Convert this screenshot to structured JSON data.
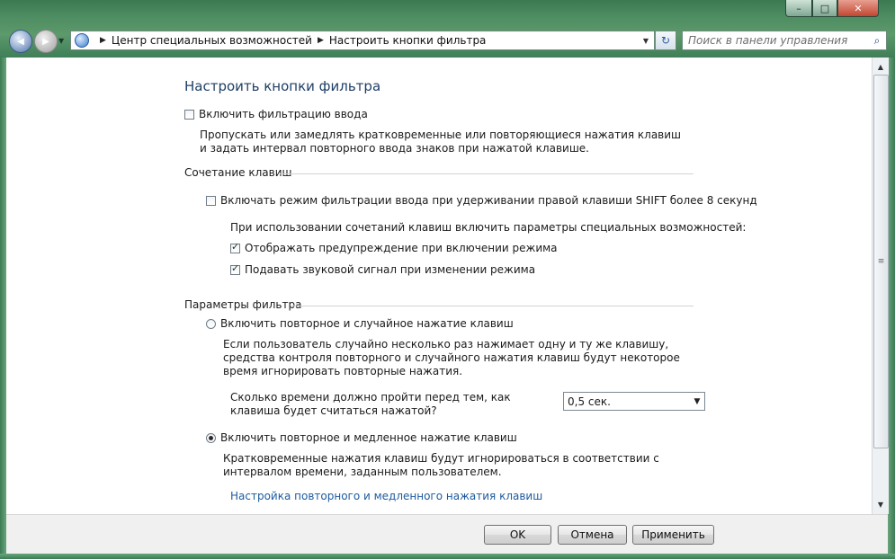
{
  "window": {
    "controls": {
      "minimize": "–",
      "maximize": "□",
      "close": "✕"
    }
  },
  "nav": {
    "back_icon": "◀",
    "forward_icon": "▶",
    "dropdown_icon": "▼"
  },
  "address": {
    "breadcrumbs": [
      "Центр специальных возможностей",
      "Настроить кнопки фильтра"
    ],
    "separator": "▶",
    "dropdown_icon": "▼"
  },
  "refresh_icon": "↻",
  "search": {
    "placeholder": "Поиск в панели управления",
    "icon": "⌕"
  },
  "page": {
    "title": "Настроить кнопки фильтра",
    "enable_filter": {
      "label": "Включить фильтрацию ввода",
      "checked": false
    },
    "enable_filter_desc": "Пропускать или замедлять кратковременные или повторяющиеся нажатия клавиш и задать интервал повторного ввода знаков при нажатой клавише.",
    "shortcut_group": {
      "title": "Сочетание клавиш",
      "shift_option": {
        "label": "Включать режим фильтрации ввода при удерживании правой клавиши SHIFT более 8 секунд",
        "checked": false
      },
      "shortcut_hint": "При использовании сочетаний клавиш включить параметры специальных возможностей:",
      "warning_option": {
        "label": "Отображать предупреждение при включении режима",
        "checked": true
      },
      "sound_option": {
        "label": "Подавать звуковой сигнал при изменении режима",
        "checked": true
      }
    },
    "filter_group": {
      "title": "Параметры фильтра",
      "repeat_random": {
        "label": "Включить повторное и случайное нажатие клавиш",
        "selected": false,
        "desc": "Если пользователь случайно несколько раз нажимает одну и ту же клавишу, средства контроля повторного и случайного нажатия клавиш будут некоторое время игнорировать повторные нажатия.",
        "wait_label": "Сколько времени должно пройти перед тем, как клавиша будет считаться нажатой?",
        "wait_value": "0,5 сек."
      },
      "repeat_slow": {
        "label": "Включить повторное и медленное нажатие клавиш",
        "selected": true,
        "desc": "Кратковременные нажатия клавиш будут игнорироваться в соответствии с интервалом времени, заданным пользователем.",
        "settings_link": "Настройка повторного и медленного нажатия клавиш"
      }
    }
  },
  "buttons": {
    "ok": "OK",
    "cancel": "Отмена",
    "apply": "Применить"
  },
  "scrollbar": {
    "up_icon": "▲",
    "down_icon": "▼",
    "grip_icon": "≡"
  }
}
